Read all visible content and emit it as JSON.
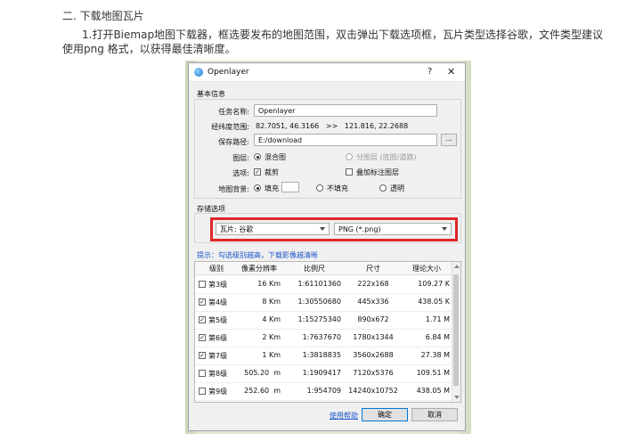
{
  "article": {
    "heading": "二. 下载地图瓦片",
    "paragraph_line1": "1.打开Biemap地图下载器，框选要发布的地图范围，双击弹出下载选项框，瓦片类型选择谷歌，文件类型建议",
    "paragraph_line2": "使用png 格式，以获得最佳清晰度。"
  },
  "dialog": {
    "title": "Openlayer",
    "help_glyph": "?",
    "close_glyph": "✕",
    "basic_info": {
      "label": "基本信息",
      "task_name_label": "任务名称:",
      "task_name_value": "Openlayer",
      "extent_label": "经纬度范围:",
      "extent_value": "82.7051, 46.3166   >>   121.816, 22.2688",
      "save_path_label": "保存路径:",
      "save_path_value": "E:/download",
      "browse_label": "...",
      "layer_label": "图层:",
      "layer_mixed": "混合图",
      "layer_split": "分图层 (底图/道路)",
      "options_label": "选项:",
      "crop_label": "裁剪",
      "overlay_label": "叠加标注图层",
      "background_label": "地图背景:",
      "fill_label": "填充",
      "no_fill_label": "不填充",
      "transparent_label": "透明"
    },
    "storage": {
      "label": "存储选项",
      "tile_type": "瓦片: 谷歌",
      "file_type": "PNG (*.png)"
    },
    "hint": "提示：勾选级别越高，下载影像越清晰",
    "table": {
      "headers": [
        "级别",
        "像素分辨率",
        "比例尺",
        "尺寸",
        "理论大小"
      ],
      "rows": [
        {
          "checked": false,
          "level": "第3级",
          "res": "16 Km",
          "scale": "1:61101360",
          "size": "222x168",
          "est": "109.27 K"
        },
        {
          "checked": true,
          "level": "第4级",
          "res": "8 Km",
          "scale": "1:30550680",
          "size": "445x336",
          "est": "438.05 K"
        },
        {
          "checked": true,
          "level": "第5级",
          "res": "4 Km",
          "scale": "1:15275340",
          "size": "890x672",
          "est": "1.71 M"
        },
        {
          "checked": true,
          "level": "第6级",
          "res": "2 Km",
          "scale": "1:7637670",
          "size": "1780x1344",
          "est": "6.84 M"
        },
        {
          "checked": true,
          "level": "第7级",
          "res": "1 Km",
          "scale": "1:3818835",
          "size": "3560x2688",
          "est": "27.38 M"
        },
        {
          "checked": false,
          "level": "第8级",
          "res": "505.20  m",
          "scale": "1:1909417",
          "size": "7120x5376",
          "est": "109.51 M"
        },
        {
          "checked": false,
          "level": "第9级",
          "res": "252.60  m",
          "scale": "1:954709",
          "size": "14240x10752",
          "est": "438.05 M"
        }
      ]
    },
    "footer": {
      "help_link": "使用帮助",
      "ok": "确定",
      "cancel": "取消"
    }
  },
  "colors": {
    "highlight": "#e0262b",
    "link": "#1d56c9"
  }
}
